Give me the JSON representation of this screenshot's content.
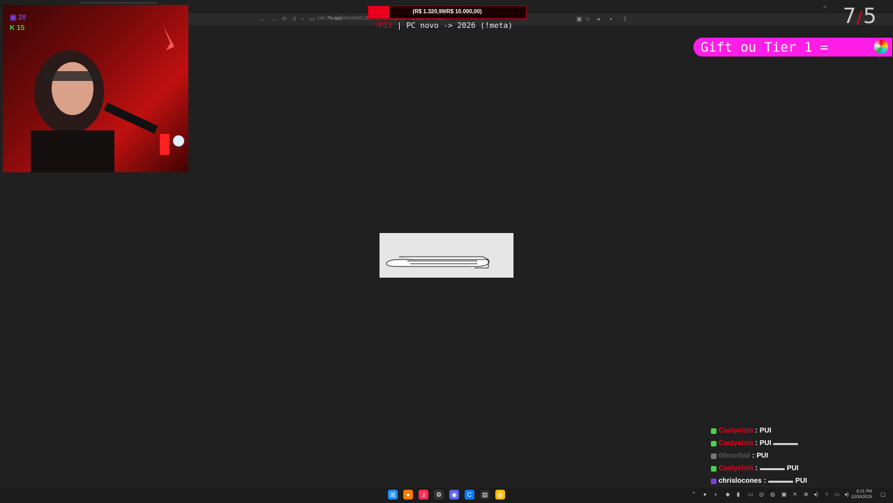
{
  "browser": {
    "url_prefix": "cdn.",
    "url_domain": "7tv.app",
    "url_path": "/emote/01JENT1VXPS6GN6PHBC5Z4M4K.avif",
    "back": "←",
    "forward": "→",
    "reload": "⟳"
  },
  "stream": {
    "counts": {
      "followers": "28",
      "kick": "15"
    },
    "donation": {
      "text": "(R$ 1.320,99/R$ 10.000,00)",
      "progress": 0.132,
      "color": "#e8001c"
    },
    "marquee": {
      "pix": "!PIX",
      "sep": " | ",
      "text": "PC novo -> 2026 (!meta)"
    },
    "goal": {
      "current": "7",
      "target": "5"
    },
    "gift_banner": {
      "text": "Gift ou Tier 1 =",
      "color": "#ff1ee8"
    }
  },
  "chat": [
    {
      "user": "Castyelzin",
      "sep": ":",
      "msg": "PUI",
      "emote": false,
      "color": "#e8001c"
    },
    {
      "user": "Castyelzin",
      "sep": ":",
      "msg": "PUI",
      "emote": true,
      "color": "#e8001c"
    },
    {
      "user": "00morbid",
      "sep": ":",
      "msg": "PUI",
      "emote": false,
      "color": "#555555"
    },
    {
      "user": "Castyelzin",
      "sep": ":",
      "msg": "PUI",
      "emote": true,
      "color": "#e8001c"
    },
    {
      "user": "chrislocones",
      "sep": ":",
      "msg": "PUI",
      "emote": true,
      "color": "#ffffff"
    }
  ],
  "taskbar": {
    "clock_time": "6:21 PM",
    "clock_date": "10/30/2025"
  }
}
